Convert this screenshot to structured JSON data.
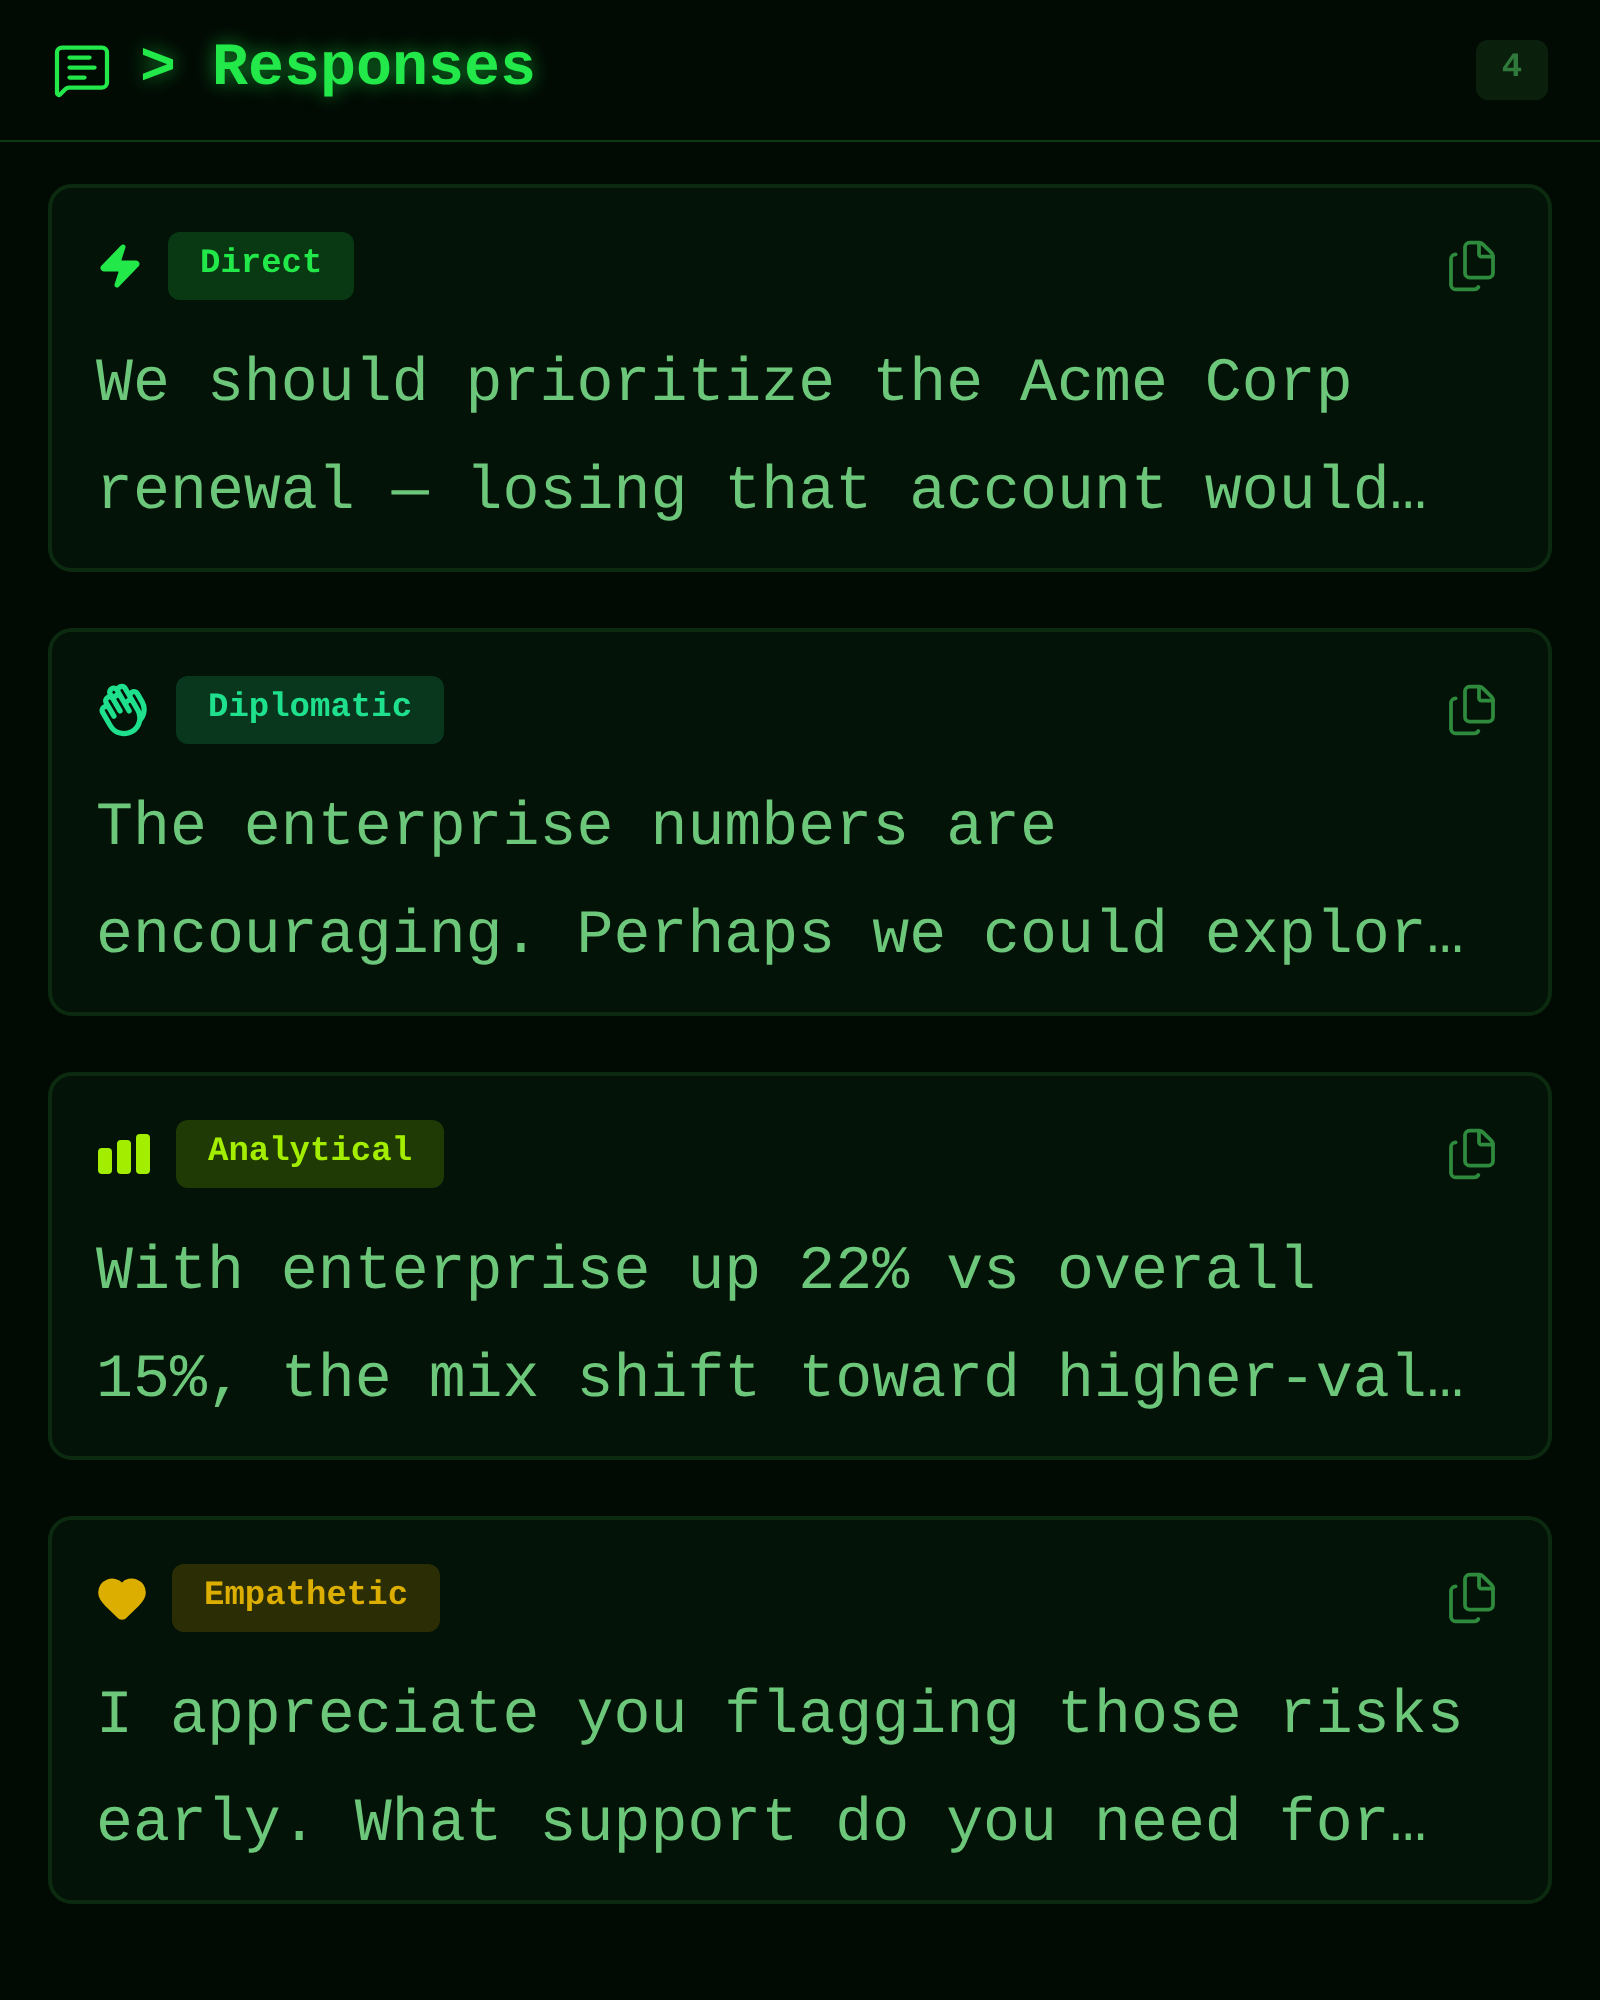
{
  "header": {
    "title": "> Responses",
    "count": "4"
  },
  "responses": [
    {
      "kind": "direct",
      "tag": "Direct",
      "color": "#22e84a",
      "text": "We should prioritize the Acme Corp renewal — losing that account would…"
    },
    {
      "kind": "diplomatic",
      "tag": "Diplomatic",
      "color": "#1fe08c",
      "text": "The enterprise numbers are encouraging. Perhaps we could explor…"
    },
    {
      "kind": "analytical",
      "tag": "Analytical",
      "color": "#a3ee00",
      "text": "With enterprise up 22% vs overall 15%, the mix shift toward higher-val…"
    },
    {
      "kind": "empathetic",
      "tag": "Empathetic",
      "color": "#dcae00",
      "text": "I appreciate you flagging those risks early. What support do you need for…"
    }
  ]
}
